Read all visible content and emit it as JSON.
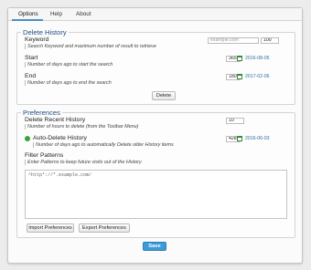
{
  "tabs": [
    {
      "label": "Options"
    },
    {
      "label": "Help"
    },
    {
      "label": "About"
    }
  ],
  "delete_history": {
    "title": "Delete History",
    "keyword": {
      "label": "Keyword",
      "hint": "Search Keyword and maximum number of result to retrieve",
      "placeholder": "example.com",
      "max_results": "100"
    },
    "start": {
      "label": "Start",
      "hint": "Number of days ago to start the search",
      "days": "365",
      "date": "2016-08-05"
    },
    "end": {
      "label": "End",
      "hint": "Number of days ago to end the search",
      "days": "180",
      "date": "2017-02-06"
    },
    "delete_button": "Delete"
  },
  "preferences": {
    "title": "Preferences",
    "delete_recent": {
      "label": "Delete Recent History",
      "hint": "Number of hours to delete (from the Toolbar Menu)",
      "hours": "10"
    },
    "auto_delete": {
      "label": "Auto-Delete History",
      "hint": "Number of days ago to automatically Delete older History items",
      "days": "428",
      "date": "2016-06-03",
      "status_color": "#3aa53a"
    },
    "filter": {
      "label": "Filter Patterns",
      "hint": "Enter Patterns to keep future visits out of the History",
      "value": "^http*://*.example.com/"
    },
    "import_button": "Import Preferences",
    "export_button": "Export Preferences"
  },
  "save_button": "Save",
  "colors": {
    "accent": "#4a90c8",
    "heading": "#1f4f85",
    "save": "#3d9ad9"
  }
}
